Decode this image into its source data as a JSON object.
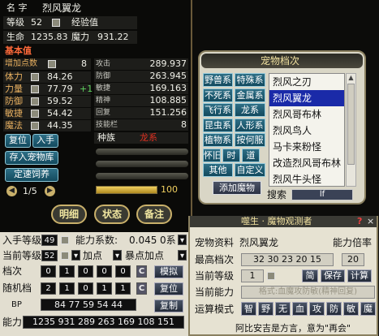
{
  "left_panel": {
    "header_tag": "名 字",
    "name": "烈风翼龙",
    "level_label": "等级",
    "level_value": "52",
    "exp_label": "经验值",
    "hp_label": "生命",
    "hp_value": "1235.83",
    "mp_label": "魔力",
    "mp_value": "931.22",
    "basic_label": "基本值",
    "points_label": "增加点数",
    "points_value": "8",
    "attributes": [
      {
        "label": "体力",
        "value": "84.26",
        "bonus": ""
      },
      {
        "label": "力量",
        "value": "77.79",
        "bonus": "+1"
      },
      {
        "label": "防御",
        "value": "59.52",
        "bonus": ""
      },
      {
        "label": "敏捷",
        "value": "54.42",
        "bonus": ""
      },
      {
        "label": "魔法",
        "value": "44.35",
        "bonus": ""
      }
    ],
    "stats": [
      {
        "label": "攻击",
        "value": "289.937"
      },
      {
        "label": "防御",
        "value": "263.945"
      },
      {
        "label": "敏捷",
        "value": "169.163"
      },
      {
        "label": "精神",
        "value": "108.885"
      },
      {
        "label": "回复",
        "value": "151.256"
      },
      {
        "label": "技能栏",
        "value": "8"
      }
    ],
    "race_label": "种族",
    "race_value": "龙系",
    "buttons": {
      "reset": "复位",
      "enter": "入手",
      "store": "存入宠物库",
      "release": "定速饲养"
    },
    "pager": "1/5",
    "bar_value": "100",
    "tabs": [
      "明细",
      "状态",
      "备注"
    ]
  },
  "archive": {
    "title": "宠物档次",
    "categories": [
      [
        "野兽系",
        "特殊系"
      ],
      [
        "不死系",
        "金属系"
      ],
      [
        "飞行系",
        "龙系"
      ],
      [
        "昆虫系",
        "人形系"
      ],
      [
        "植物系",
        "按何服"
      ],
      [
        "怀旧",
        "时",
        "道"
      ],
      [
        "其他",
        "自定义"
      ]
    ],
    "list": [
      "烈风之刃",
      "烈风翼龙",
      "烈风哥布林",
      "烈风鸟人",
      "马卡来粉怪",
      "改造烈风哥布林",
      "烈风牛头怪"
    ],
    "selected_index": 1,
    "add_button": "添加魔物",
    "search_label": "搜索",
    "search_value": "lf"
  },
  "observer": {
    "title": "噬生 · 魔物观测者",
    "pet_label": "宠物资料",
    "pet_name": "烈风翼龙",
    "ability_label": "能力倍率",
    "max_level_label": "最高档次",
    "max_level_values": "32 30 23 20 15",
    "ratio_value": "20",
    "cur_level_label": "当前等级",
    "cur_level_value": "1",
    "btn_simple": "简",
    "btn_save": "保存",
    "btn_calc": "计算",
    "cur_ability_label": "当前能力",
    "cur_ability_placeholder": "格式:血魔攻防敏(精神回复)",
    "mode_label": "运算模式",
    "modes": [
      "智",
      "野",
      "无",
      "血",
      "攻",
      "防",
      "敏",
      "魔"
    ],
    "footer": "阿比安吉是方言，意为\"再会\""
  },
  "bottom_left": {
    "entry_level_label": "入手等级",
    "entry_level_value": "49",
    "coef_label": "能力系数:",
    "coef_value": "0.045",
    "coef_unit": "0系",
    "cur_level_label": "当前等级",
    "cur_level_value": "52",
    "add_label": "加点",
    "crit_label": "暴点加点",
    "grade_label": "档次",
    "grade_values": [
      "0",
      "1",
      "0",
      "0",
      "0"
    ],
    "simulate_button": "模拟",
    "random_label": "随机档",
    "random_values": [
      "2",
      "1",
      "0",
      "1",
      "1"
    ],
    "reset_button": "复位",
    "bp_label": "BP",
    "bp_value": "84 77 59 54 44",
    "copy_button": "复制",
    "power_label": "能力",
    "power_value": "1235 931 289 263 169 108 151"
  }
}
